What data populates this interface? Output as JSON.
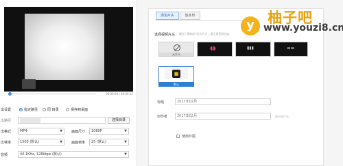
{
  "player": {
    "time": "00:00:00 / 00:00:12"
  },
  "options": {
    "section_label": "出设置",
    "radios": [
      {
        "label": "指定路径",
        "selected": true
      },
      {
        "label": "同 目录",
        "selected": false
      },
      {
        "label": "保存到桌面",
        "selected": false
      }
    ],
    "path_label": "出路径",
    "browse_button": "选择目录",
    "format_label": "出格式",
    "format_value": "MP4",
    "size_label": "画面尺寸",
    "size_value": "1080P",
    "bitrate_label": "比特率",
    "bitrate_value": "1500 (默认)",
    "framerate_label": "画面帧率",
    "framerate_value": "25 (默认)",
    "audio_label": "音频",
    "audio_value": "44.1KHz, 128kbps (默认)"
  },
  "panel": {
    "tabs": [
      {
        "label": "添加片头",
        "active": true
      },
      {
        "label": "加水印",
        "active": false
      }
    ],
    "select_label": "选择视频片头",
    "select_hint": "最长只截取前  秒为片头，请注意视频长度",
    "tiles": [
      {
        "caption": "无片头"
      },
      {
        "caption": ""
      },
      {
        "caption": ""
      },
      {
        "caption": ""
      },
      {
        "caption": "默认"
      }
    ],
    "title_label": "标题",
    "title_value": "2017年02月",
    "author_label": "创作者",
    "author_value": "2017年02月",
    "author_hint": "显示在片头",
    "checkbox_label": "使用片尾"
  },
  "watermark": {
    "logo_letter": "y",
    "name": "柚子吧",
    "url": "www.youzi8.cn"
  },
  "colors": {
    "accent": "#2d7fd6",
    "watermark_orange": "#f6b21b"
  }
}
